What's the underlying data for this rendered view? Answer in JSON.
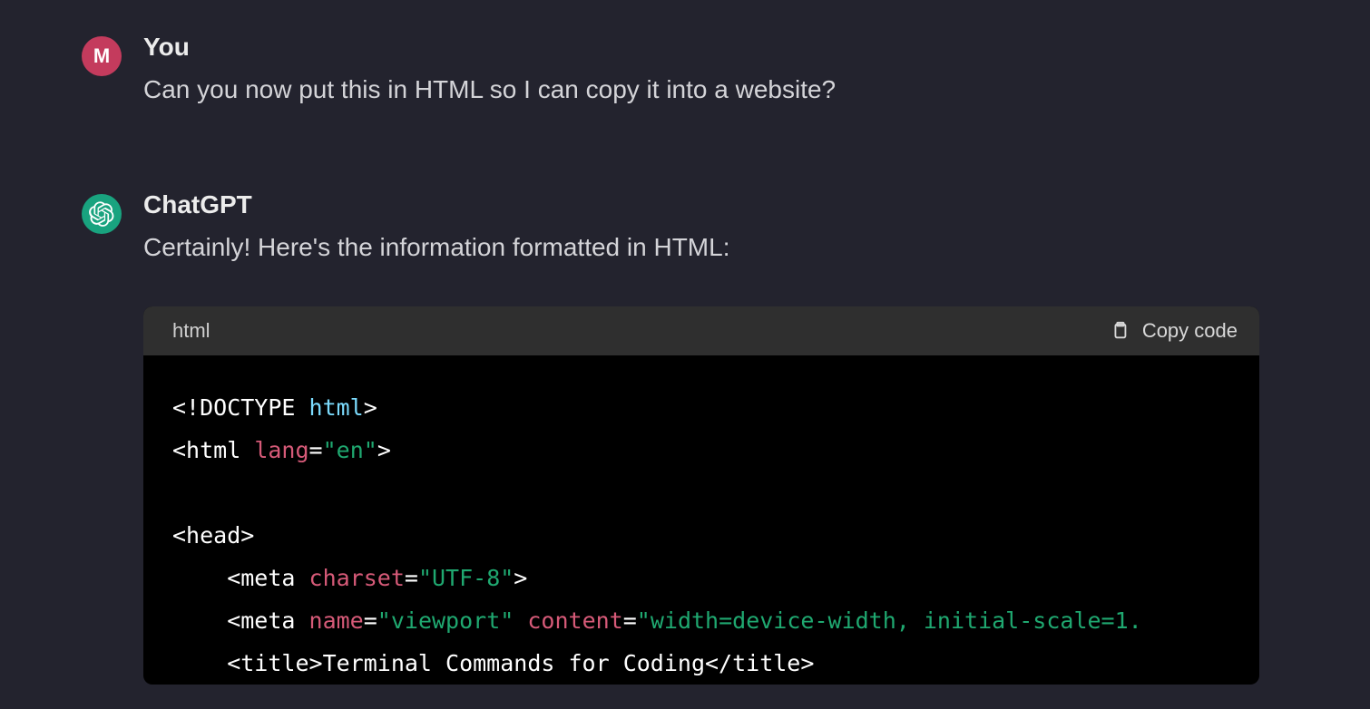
{
  "user": {
    "avatar_letter": "M",
    "name": "You",
    "message": "Can you now put this in HTML so I can copy it into a website?"
  },
  "assistant": {
    "name": "ChatGPT",
    "intro": "Certainly! Here's the information formatted in HTML:"
  },
  "code": {
    "language": "html",
    "copy_label": "Copy code",
    "tokens": {
      "t1a": "<!DOCTYPE ",
      "t1b": "html",
      "t1c": ">",
      "t2a": "<html ",
      "t2b": "lang",
      "t2c": "=",
      "t2d": "\"en\"",
      "t2e": ">",
      "t3": "<head>",
      "t4a": "    <meta ",
      "t4b": "charset",
      "t4c": "=",
      "t4d": "\"UTF-8\"",
      "t4e": ">",
      "t5a": "    <meta ",
      "t5b": "name",
      "t5c": "=",
      "t5d": "\"viewport\"",
      "t5e": " ",
      "t5f": "content",
      "t5g": "=",
      "t5h": "\"width=device-width, initial-scale=1.",
      "t6": "    <title>Terminal Commands for Coding</title>"
    }
  }
}
